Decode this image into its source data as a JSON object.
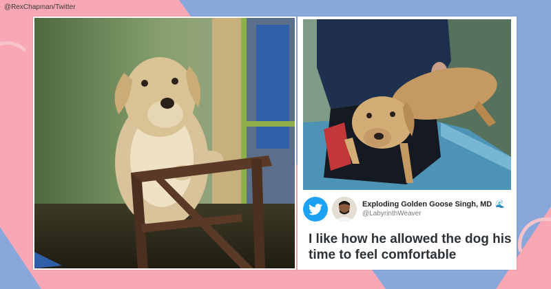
{
  "credit": "@RexChapman/Twitter",
  "tweet": {
    "display_name": "Exploding Golden Goose Singh, MD",
    "handle": "@LabyrinthWeaver",
    "text": "I like how he allowed the dog his time to feel comfortable"
  },
  "icons": {
    "platform": "twitter-bird-icon",
    "name_emoji": "water-wave-icon"
  },
  "colors": {
    "pink_background": "#f7a8b4",
    "blue_background": "#8aa7dc",
    "twitter_blue": "#1da1f2"
  }
}
